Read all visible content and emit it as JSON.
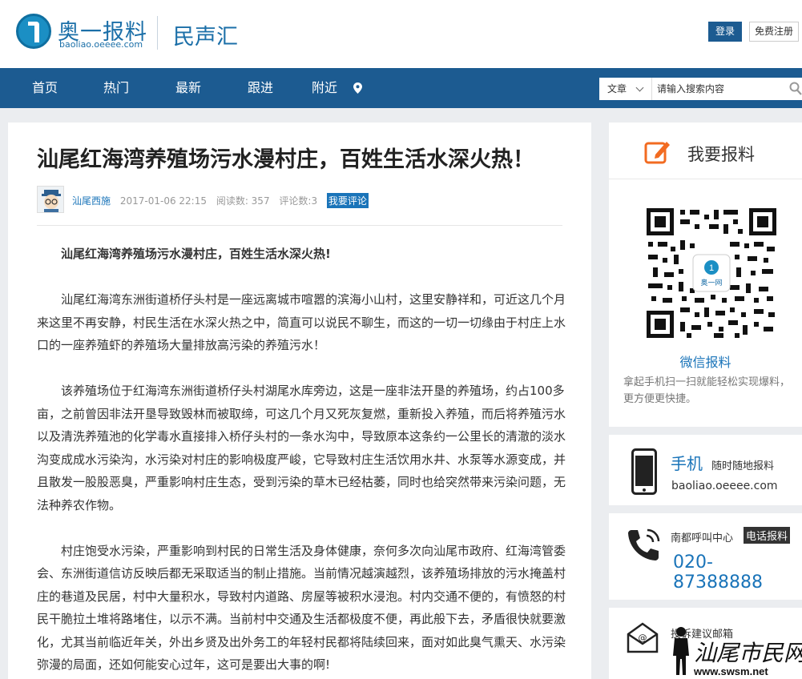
{
  "header": {
    "brand_name": "奥一报料",
    "brand_url": "baoliao.oeeee.com",
    "section_name": "民声汇",
    "login": "登录",
    "register": "免费注册"
  },
  "nav": {
    "items": [
      "首页",
      "热门",
      "最新",
      "跟进",
      "附近"
    ],
    "search_scope": "文章",
    "search_placeholder": "请输入搜索内容"
  },
  "article": {
    "title": "汕尾红海湾养殖场污水漫村庄，百姓生活水深火热！",
    "author": "汕尾西施",
    "datetime": "2017-01-06 22:15",
    "reads": "阅读数: 357",
    "comments": "评论数:3",
    "comment_button": "我要评论",
    "lead": "汕尾红海湾养殖场污水漫村庄，百姓生活水深火热!",
    "paragraphs": [
      "汕尾红海湾东洲街道桥仔头村是一座远离城市喧嚣的滨海小山村，这里安静祥和，可近这几个月来这里不再安静，村民生活在水深火热之中，简直可以说民不聊生，而这的一切一切缘由于村庄上水口的一座养殖虾的养殖场大量排放高污染的养殖污水！",
      "该养殖场位于红海湾东洲街道桥仔头村湖尾水库旁边，这是一座非法开垦的养殖场，约占100多亩，之前曾因非法开垦导致毁林而被取缔，可这几个月又死灰复燃，重新投入养殖，而后将养殖污水以及清洗养殖池的化学毒水直接排入桥仔头村的一条水沟中，导致原本这条约一公里长的清澈的淡水沟变成成水污染沟，水污染对村庄的影响极度严峻，它导致村庄生活饮用水井、水泵等水源变成，并且散发一股股恶臭，严重影响村庄生态，受到污染的草木已经枯萎，同时也给突然带来污染问题，无法种养农作物。",
      "村庄饱受水污染，严重影响到村民的日常生活及身体健康，奈何多次向汕尾市政府、红海湾管委会、东洲街道信访反映后都无采取适当的制止措施。当前情况越演越烈，该养殖场排放的污水掩盖村庄的巷道及民居，村中大量积水，导致村内道路、房屋等被积水浸泡。村内交通不便的，有愤怒的村民干脆拉土堆将路堵住，以示不满。当前村中交通及生活都极度不便，再此般下去，矛盾很快就要激化，尤其当前临近年关，外出乡贤及出外务工的年轻村民都将陆续回来，面对如此臭气熏天、水污染弥漫的局面，还如何能安心过年，这可是要出大事的啊!"
    ]
  },
  "sidebar": {
    "report_title": "我要报料",
    "qr_badge": "奥一网",
    "wechat_label": "微信报料",
    "wechat_desc": "拿起手机扫一扫就能轻松实现爆料，更方便更快捷。",
    "mobile_title": "手机",
    "mobile_tag": "随时随地报料",
    "mobile_url": "baoliao.oeeee.com",
    "call_label": "南都呼叫中心",
    "call_tag": "电话报料",
    "call_number": "020-87388888",
    "mail_label": "投诉建议邮箱"
  },
  "watermark": {
    "name": "汕尾市民网",
    "url": "www.swsm.net"
  },
  "colors": {
    "brand_blue": "#1c5b91",
    "link_blue": "#1a74b9",
    "report_orange": "#f26b21"
  }
}
